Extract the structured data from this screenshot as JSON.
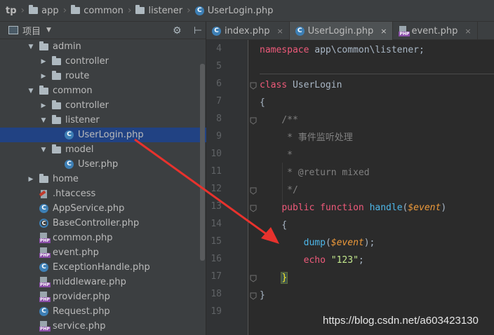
{
  "breadcrumb": [
    "tp",
    "app",
    "common",
    "listener",
    "UserLogin.php"
  ],
  "project_panel": {
    "title": "项目"
  },
  "tree": [
    {
      "label": "admin",
      "type": "folder",
      "depth": 1,
      "expanded": true
    },
    {
      "label": "controller",
      "type": "folder",
      "depth": 2,
      "expanded": false
    },
    {
      "label": "route",
      "type": "folder",
      "depth": 2,
      "expanded": false
    },
    {
      "label": "common",
      "type": "folder",
      "depth": 1,
      "expanded": true
    },
    {
      "label": "controller",
      "type": "folder",
      "depth": 2,
      "expanded": false
    },
    {
      "label": "listener",
      "type": "folder",
      "depth": 2,
      "expanded": true
    },
    {
      "label": "UserLogin.php",
      "type": "class",
      "depth": 3,
      "selected": true
    },
    {
      "label": "model",
      "type": "folder",
      "depth": 2,
      "expanded": true
    },
    {
      "label": "User.php",
      "type": "class",
      "depth": 3
    },
    {
      "label": "home",
      "type": "folder",
      "depth": 1,
      "expanded": false
    },
    {
      "label": ".htaccess",
      "type": "htaccess",
      "depth": 1
    },
    {
      "label": "AppService.php",
      "type": "class",
      "depth": 1
    },
    {
      "label": "BaseController.php",
      "type": "base",
      "depth": 1
    },
    {
      "label": "common.php",
      "type": "php",
      "depth": 1
    },
    {
      "label": "event.php",
      "type": "php",
      "depth": 1
    },
    {
      "label": "ExceptionHandle.php",
      "type": "class",
      "depth": 1
    },
    {
      "label": "middleware.php",
      "type": "php",
      "depth": 1
    },
    {
      "label": "provider.php",
      "type": "php",
      "depth": 1
    },
    {
      "label": "Request.php",
      "type": "class",
      "depth": 1
    },
    {
      "label": "service.php",
      "type": "php",
      "depth": 1
    }
  ],
  "tabs": [
    {
      "label": "index.php",
      "icon": "class",
      "active": false
    },
    {
      "label": "UserLogin.php",
      "icon": "class",
      "active": true
    },
    {
      "label": "event.php",
      "icon": "php",
      "active": false
    }
  ],
  "tab_close": "×",
  "line_numbers": [
    "4",
    "5",
    "6",
    "7",
    "8",
    "9",
    "10",
    "11",
    "12",
    "13",
    "14",
    "15",
    "16",
    "17",
    "18",
    "19"
  ],
  "code": {
    "l4_kw": "namespace",
    "l4_rest": " app\\common\\listener;",
    "l6_kw": "class",
    "l6_rest": " UserLogin",
    "l7": "{",
    "l8": "    /**",
    "l9": "     * 事件监听处理",
    "l10": "     *",
    "l11": "     * @return mixed",
    "l12": "     */",
    "l13_kw1": "public",
    "l13_kw2": "function",
    "l13_fn": "handle",
    "l13_open": "(",
    "l13_var": "$event",
    "l13_close": ")",
    "l14": "    {",
    "l15_fn": "dump",
    "l15_open": "(",
    "l15_var": "$event",
    "l15_close": ");",
    "l16_kw": "echo",
    "l16_str": "\"123\"",
    "l16_end": ";",
    "l17": "}",
    "l18": "}"
  },
  "watermark": "https://blog.csdn.net/a603423130",
  "colors": {
    "annotation_arrow": "#e8322d",
    "keyword": "#cc7832",
    "string": "#6a8759",
    "comment": "#808080",
    "selection": "#214283"
  }
}
